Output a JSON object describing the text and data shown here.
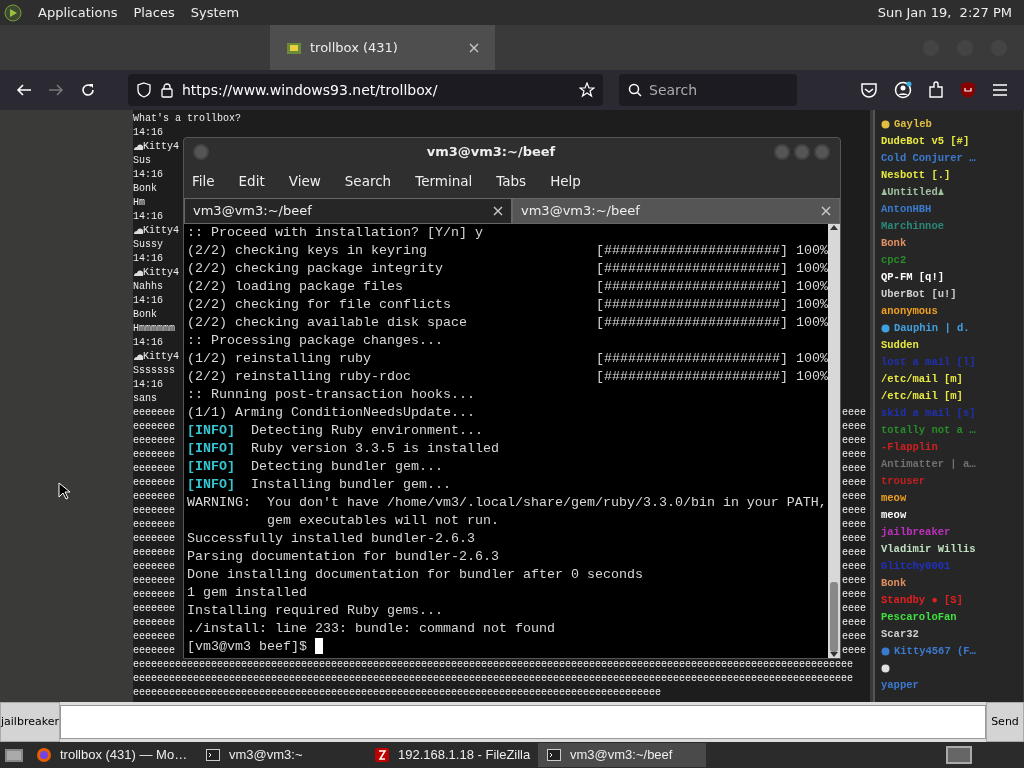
{
  "panel": {
    "menus": [
      "Applications",
      "Places",
      "System"
    ],
    "clock": "Sun Jan 19,  2:27 PM"
  },
  "browser": {
    "tabs": [
      {
        "label": "trollbox (431)",
        "selected": true
      }
    ],
    "url": "https://www.windows93.net/trollbox/",
    "search": {
      "placeholder": "Search"
    }
  },
  "chat": {
    "lines": [
      {
        "text": "What's a trollbox?"
      },
      {
        "text": "14:16"
      },
      {
        "text": "Kitty4",
        "icon": true
      },
      {
        "text": "Sus"
      },
      {
        "text": "14:16"
      },
      {
        "text": "Bonk"
      },
      {
        "text": "Hm"
      },
      {
        "text": "14:16"
      },
      {
        "text": "Kitty4",
        "icon": true
      },
      {
        "text": "Sussy"
      },
      {
        "text": "14:16"
      },
      {
        "text": "Kitty4",
        "icon": true
      },
      {
        "text": "Nahhs"
      },
      {
        "text": "14:16"
      },
      {
        "text": "Bonk"
      },
      {
        "text": "Hmmmmmm"
      },
      {
        "text": "14:16"
      },
      {
        "text": "Kitty4",
        "icon": true
      },
      {
        "text": "Sssssss"
      },
      {
        "text": "14:16"
      },
      {
        "text": "sans"
      },
      {
        "text": "eeeeeee",
        "tail": "eeee"
      },
      {
        "text": "eeeeeee",
        "tail": "eeee"
      },
      {
        "text": "eeeeeee",
        "tail": "eeee"
      },
      {
        "text": "eeeeeee",
        "tail": "eeee"
      },
      {
        "text": "eeeeeee",
        "tail": "eeee"
      },
      {
        "text": "eeeeeee",
        "tail": "eeee"
      },
      {
        "text": "eeeeeee",
        "tail": "eeee"
      },
      {
        "text": "eeeeeee",
        "tail": "eeee"
      },
      {
        "text": "eeeeeee",
        "tail": "eeee"
      },
      {
        "text": "eeeeeee",
        "tail": "eeee"
      },
      {
        "text": "eeeeeee",
        "tail": "eeee"
      },
      {
        "text": "eeeeeee",
        "tail": "eeee"
      },
      {
        "text": "eeeeeee",
        "tail": "eeee"
      },
      {
        "text": "eeeeeee",
        "tail": "eeee"
      },
      {
        "text": "eeeeeee",
        "tail": "eeee"
      },
      {
        "text": "eeeeeee",
        "tail": "eeee"
      },
      {
        "text": "eeeeeee",
        "tail": "eeee"
      },
      {
        "text": "eeeeeee",
        "tail": "eeee"
      },
      {
        "text": "eeeeeeeeeeeeeeeeeeeeeeeeeeeeeeeeeeeeeeeeeeeeeeeeeeeeeeeeeeeeeeeeeeeeeeeeeeeeeeeeeeeeeeeeeeeeeeeeeeeeeeeeeeeeeeeeeeeeeeee"
      },
      {
        "text": "eeeeeeeeeeeeeeeeeeeeeeeeeeeeeeeeeeeeeeeeeeeeeeeeeeeeeeeeeeeeeeeeeeeeeeeeeeeeeeeeeeeeeeeeeeeeeeeeeeeeeeeeeeeeeeeeeeeeeeee"
      },
      {
        "text": "eeeeeeeeeeeeeeeeeeeeeeeeeeeeeeeeeeeeeeeeeeeeeeeeeeeeeeeeeeeeeeeeeeeeeeeeeeeeeeeeeeeeeeee"
      }
    ],
    "nick": "jailbreaker",
    "send": "Send"
  },
  "users": [
    {
      "name": "Gayleb",
      "color": "#e0c040",
      "icon": true
    },
    {
      "name": "DudeBot v5 [#]",
      "color": "#e8e840"
    },
    {
      "name": "Cold Conjurer …",
      "color": "#3a7ad0"
    },
    {
      "name": "Nesbott [.]",
      "color": "#e8e840"
    },
    {
      "name": "♟Untitled♟",
      "color": "#a0c0a0"
    },
    {
      "name": "AntonHBH",
      "color": "#3a7ad0"
    },
    {
      "name": "Marchinnoe",
      "color": "#2a8a7a"
    },
    {
      "name": "Bonk",
      "color": "#e09060"
    },
    {
      "name": "cpc2",
      "color": "#2a8a2a"
    },
    {
      "name": "QP-FM [q!]",
      "color": "#ffffff"
    },
    {
      "name": "UberBot [u!]",
      "color": "#d0d0d0"
    },
    {
      "name": "anonymous",
      "color": "#f0a020"
    },
    {
      "name": "Dauphin | d.",
      "color": "#40a0e0",
      "icon": true
    },
    {
      "name": "Sudden",
      "color": "#e8e840"
    },
    {
      "name": "lost a mail [l]",
      "color": "#2030b0"
    },
    {
      "name": "/etc/mail [m]",
      "color": "#e8e840"
    },
    {
      "name": "/etc/mail [m]",
      "color": "#e8e840"
    },
    {
      "name": "skid a mail [s]",
      "color": "#2030b0"
    },
    {
      "name": "totally not a …",
      "color": "#2a8a2a"
    },
    {
      "name": "-Flapplin",
      "color": "#d02020"
    },
    {
      "name": "Antimatter | a…",
      "color": "#707070"
    },
    {
      "name": "trouser",
      "color": "#c02020"
    },
    {
      "name": "meow",
      "color": "#f0a020"
    },
    {
      "name": "meow",
      "color": "#ffffff"
    },
    {
      "name": "jailbreaker",
      "color": "#c030c0"
    },
    {
      "name": "Vladimir Willis",
      "color": "#c0e0c0"
    },
    {
      "name": "Glitchy0001",
      "color": "#2030c0"
    },
    {
      "name": "Bonk",
      "color": "#e09060"
    },
    {
      "name": "Standby ● [S]",
      "color": "#e02020"
    },
    {
      "name": "PescaroloFan",
      "color": "#40e040"
    },
    {
      "name": "Scar32",
      "color": "#d0d0d0"
    },
    {
      "name": "Kitty4567 (F…",
      "color": "#3a7ad0",
      "icon": true
    },
    {
      "color": "#e0e0e0",
      "icon": true
    },
    {
      "name": "yapper",
      "color": "#3a7ad0"
    }
  ],
  "terminal": {
    "title": "vm3@vm3:~/beef",
    "menus": [
      "File",
      "Edit",
      "View",
      "Search",
      "Terminal",
      "Tabs",
      "Help"
    ],
    "tabs": [
      {
        "label": "vm3@vm3:~/beef",
        "selected": true
      },
      {
        "label": "vm3@vm3:~/beef",
        "selected": false
      }
    ],
    "lines": [
      {
        "kind": "plain",
        "text": ":: Proceed with installation? [Y/n] y"
      },
      {
        "kind": "progress",
        "text": "(2/2) checking keys in keyring",
        "bar": "[######################] 100%"
      },
      {
        "kind": "progress",
        "text": "(2/2) checking package integrity",
        "bar": "[######################] 100%"
      },
      {
        "kind": "progress",
        "text": "(2/2) loading package files",
        "bar": "[######################] 100%"
      },
      {
        "kind": "progress",
        "text": "(2/2) checking for file conflicts",
        "bar": "[######################] 100%"
      },
      {
        "kind": "progress",
        "text": "(2/2) checking available disk space",
        "bar": "[######################] 100%"
      },
      {
        "kind": "plain",
        "text": ":: Processing package changes..."
      },
      {
        "kind": "progress",
        "text": "(1/2) reinstalling ruby",
        "bar": "[######################] 100%"
      },
      {
        "kind": "progress",
        "text": "(2/2) reinstalling ruby-rdoc",
        "bar": "[######################] 100%"
      },
      {
        "kind": "plain",
        "text": ":: Running post-transaction hooks..."
      },
      {
        "kind": "plain",
        "text": "(1/1) Arming ConditionNeedsUpdate..."
      },
      {
        "kind": "info",
        "tag": "[INFO]",
        "text": "Detecting Ruby environment..."
      },
      {
        "kind": "info",
        "tag": "[INFO]",
        "text": "Ruby version 3.3.5 is installed"
      },
      {
        "kind": "info",
        "tag": "[INFO]",
        "text": "Detecting bundler gem..."
      },
      {
        "kind": "info",
        "tag": "[INFO]",
        "text": "Installing bundler gem..."
      },
      {
        "kind": "plain",
        "text": "WARNING:  You don't have /home/vm3/.local/share/gem/ruby/3.3.0/bin in your PATH,"
      },
      {
        "kind": "plain",
        "text": "          gem executables will not run."
      },
      {
        "kind": "plain",
        "text": "Successfully installed bundler-2.6.3"
      },
      {
        "kind": "plain",
        "text": "Parsing documentation for bundler-2.6.3"
      },
      {
        "kind": "plain",
        "text": "Done installing documentation for bundler after 0 seconds"
      },
      {
        "kind": "plain",
        "text": "1 gem installed"
      },
      {
        "kind": "plain",
        "text": "Installing required Ruby gems..."
      },
      {
        "kind": "plain",
        "text": "./install: line 233: bundle: command not found"
      },
      {
        "kind": "prompt",
        "text": "[vm3@vm3 beef]$ "
      }
    ]
  },
  "taskbar": [
    {
      "kind": "firefox",
      "label": "trollbox (431) — Mo…",
      "selected": false
    },
    {
      "kind": "terminal",
      "label": "vm3@vm3:~",
      "selected": false
    },
    {
      "kind": "filezilla",
      "label": "192.168.1.18 - FileZilla",
      "selected": false
    },
    {
      "kind": "terminal",
      "label": "vm3@vm3:~/beef",
      "selected": true
    }
  ]
}
